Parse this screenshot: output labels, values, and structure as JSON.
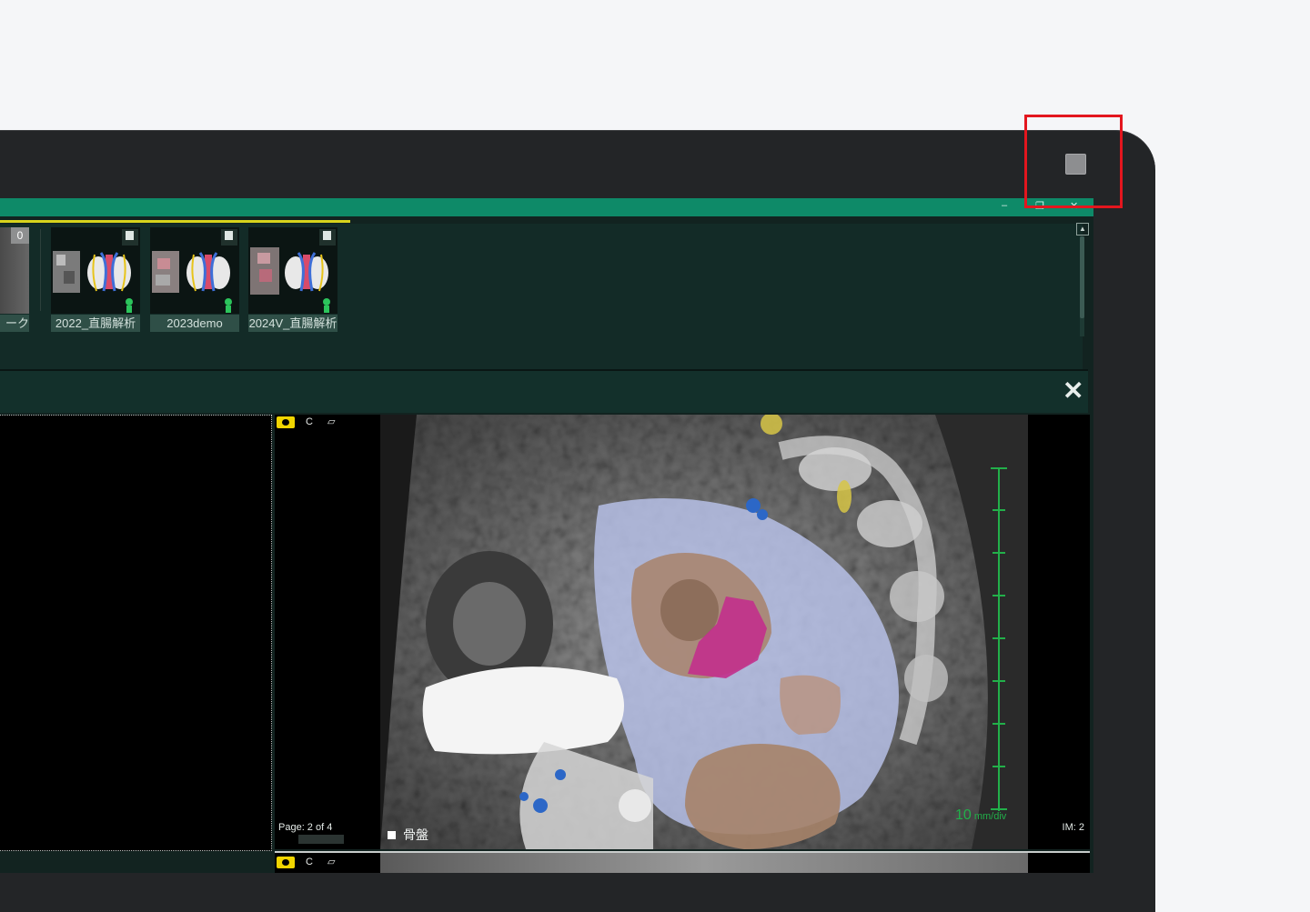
{
  "window": {
    "controls": [
      "–",
      "❐",
      "✕"
    ]
  },
  "thumbnails": {
    "partial_index": "0",
    "partial_label": "ーク",
    "items": [
      {
        "label": "2022_直腸解析"
      },
      {
        "label": "2023demo"
      },
      {
        "label": "2024V_直腸解析"
      }
    ]
  },
  "viewer": {
    "series_label": "C",
    "page_info": "Page: 2 of 4",
    "im_info": "IM: 2",
    "scale_value": "10",
    "scale_unit": "mm/div",
    "segment_label": "骨盤"
  },
  "colors": {
    "accent": "#0e8a68",
    "highlight_box": "#e3161e",
    "eye_icon": "#f1d500",
    "scale": "#22b04a"
  }
}
